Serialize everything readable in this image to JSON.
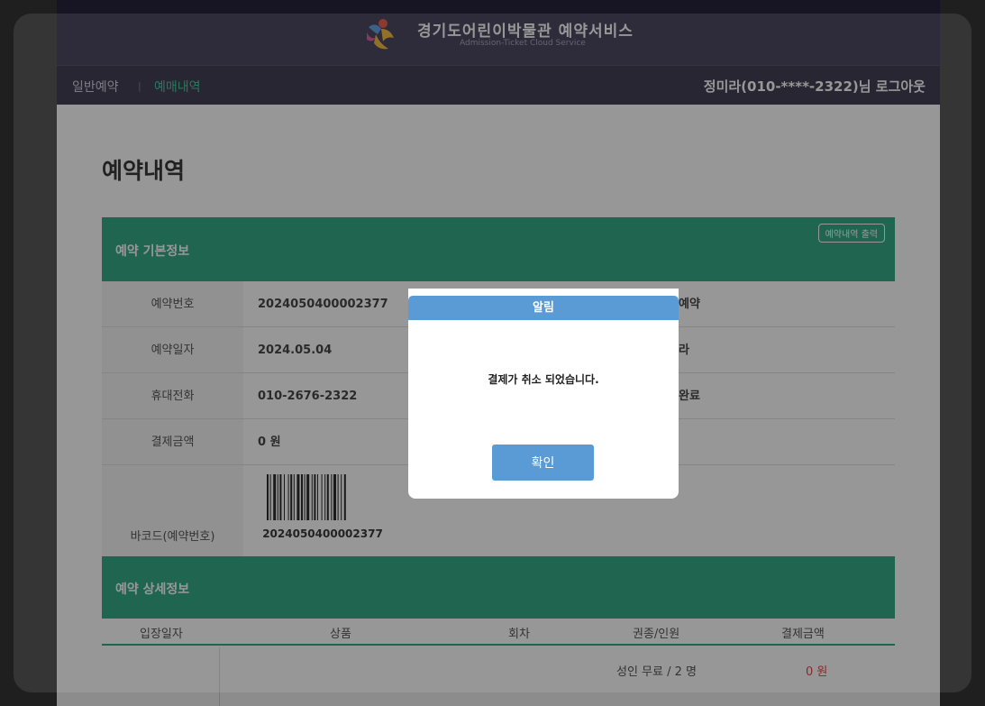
{
  "header": {
    "brand_title": "경기도어린이박물관 예약서비스",
    "brand_subtitle": "Admission-Ticket Cloud Service",
    "logo_icon": "museum-logo-icon"
  },
  "nav": {
    "general_reservation": "일반예약",
    "separator": "|",
    "reservation_history": "예매내역",
    "user_logout": "정미라(010-****-2322)님 로그아웃"
  },
  "page": {
    "title": "예약내역"
  },
  "basic_info": {
    "section_title": "예약 기본정보",
    "print_button": "예약내역 출력",
    "rows": [
      {
        "key": "예약번호",
        "value": "2024050400002377",
        "value2": "예약"
      },
      {
        "key": "예약일자",
        "value": "2024.05.04",
        "value2": "라"
      },
      {
        "key": "휴대전화",
        "value": "010-2676-2322",
        "value2": "완료"
      },
      {
        "key": "결제금액",
        "value": "0 원",
        "value2": ""
      }
    ],
    "barcode_label": "바코드(예약번호)",
    "barcode_number": "2024050400002377"
  },
  "detail_info": {
    "section_title": "예약 상세정보",
    "columns": [
      "입장일자",
      "상품",
      "회차",
      "권종/인원",
      "결제금액"
    ],
    "row": {
      "ticket": "성인 무료 / 2 명",
      "amount": "0 원"
    }
  },
  "dialog": {
    "title": "알림",
    "message": "결제가 취소 되었습니다.",
    "ok_button": "확인"
  },
  "colors": {
    "header_bg": "#2a2542",
    "section_green": "#0e9a6d",
    "dialog_blue": "#5b9bd5",
    "amount_red": "#e02020"
  }
}
